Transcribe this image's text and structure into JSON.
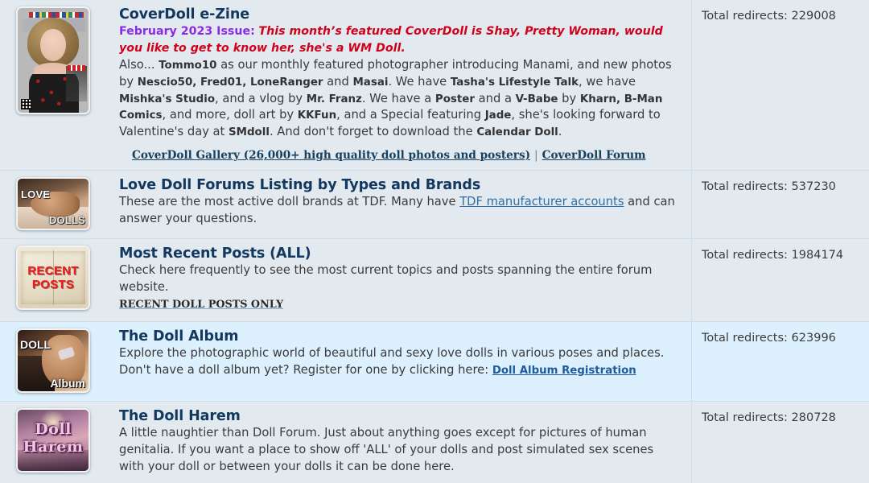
{
  "stats_label": "Total redirects:",
  "rows": [
    {
      "id": "coverdoll-e-zine",
      "thumb_name": "coverdoll-magazine-cover-thumbnail",
      "title": "CoverDoll e-Zine",
      "issue_label": "February 2023 Issue:",
      "issue_text": "This month’s featured CoverDoll is Shay, Pretty Woman, would you like to get to know her, she's a WM Doll.",
      "body_parts": [
        {
          "t": "Also... ",
          "b": false
        },
        {
          "t": "Tommo10",
          "b": true
        },
        {
          "t": " as our monthly featured photographer introducing Manami, and new photos by ",
          "b": false
        },
        {
          "t": "Nescio50, Fred01, LoneRanger",
          "b": true
        },
        {
          "t": " and ",
          "b": false
        },
        {
          "t": "Masai",
          "b": true
        },
        {
          "t": ". We have ",
          "b": false
        },
        {
          "t": "Tasha's Lifestyle Talk",
          "b": true
        },
        {
          "t": ", we have ",
          "b": false
        },
        {
          "t": "Mishka's Studio",
          "b": true
        },
        {
          "t": ", and a vlog by ",
          "b": false
        },
        {
          "t": "Mr. Franz",
          "b": true
        },
        {
          "t": ". We have a ",
          "b": false
        },
        {
          "t": "Poster",
          "b": true
        },
        {
          "t": " and a ",
          "b": false
        },
        {
          "t": "V-Babe",
          "b": true
        },
        {
          "t": " by ",
          "b": false
        },
        {
          "t": "Kharn, B-Man Comics",
          "b": true
        },
        {
          "t": ", and more, doll art by ",
          "b": false
        },
        {
          "t": "KKFun",
          "b": true
        },
        {
          "t": ", and a Special featuring ",
          "b": false
        },
        {
          "t": "Jade",
          "b": true
        },
        {
          "t": ", she's looking forward to Valentine's day at ",
          "b": false
        },
        {
          "t": "SMdoll",
          "b": true
        },
        {
          "t": ". And don't forget to download the ",
          "b": false
        },
        {
          "t": "Calendar Doll",
          "b": true
        },
        {
          "t": ".",
          "b": false
        }
      ],
      "footer_links": [
        "CoverDoll Gallery (26,000+ high quality doll photos and posters)",
        "CoverDoll Forum"
      ],
      "footer_separator": "|",
      "redirects": "229008"
    },
    {
      "id": "love-doll-forums-listing",
      "thumb_name": "love-dolls-thumbnail",
      "thumb_text_top": "LOVE",
      "thumb_text_bottom": "DOLLS",
      "title": "Love Doll Forums Listing by Types and Brands",
      "desc_before": "These are the most active doll brands at TDF. Many have ",
      "inline_link": "TDF manufacturer accounts",
      "desc_after": " and can answer your questions.",
      "redirects": "537230"
    },
    {
      "id": "most-recent-posts",
      "thumb_name": "recent-posts-thumbnail",
      "thumb_text": "RECENT POSTS",
      "title": "Most Recent Posts (ALL)",
      "desc": "Check here frequently to see the most current topics and posts spanning the entire forum website.",
      "sub_link": "RECENT DOLL POSTS ONLY",
      "redirects": "1984174"
    },
    {
      "id": "the-doll-album",
      "thumb_name": "doll-album-thumbnail",
      "thumb_text_top": "DOLL",
      "thumb_text_bottom": "Album",
      "title": "The Doll Album",
      "desc_line1": "Explore the photographic world of beautiful and sexy love dolls in various poses and places.",
      "desc_line2": "Don't have a doll album yet? Register for one by clicking here: ",
      "inline_link": "Doll Album Registration",
      "redirects": "623996"
    },
    {
      "id": "the-doll-harem",
      "thumb_name": "doll-harem-thumbnail",
      "thumb_text": "Doll Harem",
      "title": "The Doll Harem",
      "desc": "A little naughtier than Doll Forum. Just about anything goes except for pictures of human genitalia. If you want a place to show off 'ALL' of your dolls and post simulated sex scenes with your doll or between your dolls it can be done here.",
      "redirects": "280728"
    }
  ],
  "colors": {
    "row_shade_a": "#e2eaf0",
    "row_shade_b": "#ddf0fd",
    "title": "#13385f",
    "link": "#2f6fa8",
    "issue_label": "#8a2be2",
    "issue_text": "#d0021b",
    "divider": "#cfdde6"
  }
}
